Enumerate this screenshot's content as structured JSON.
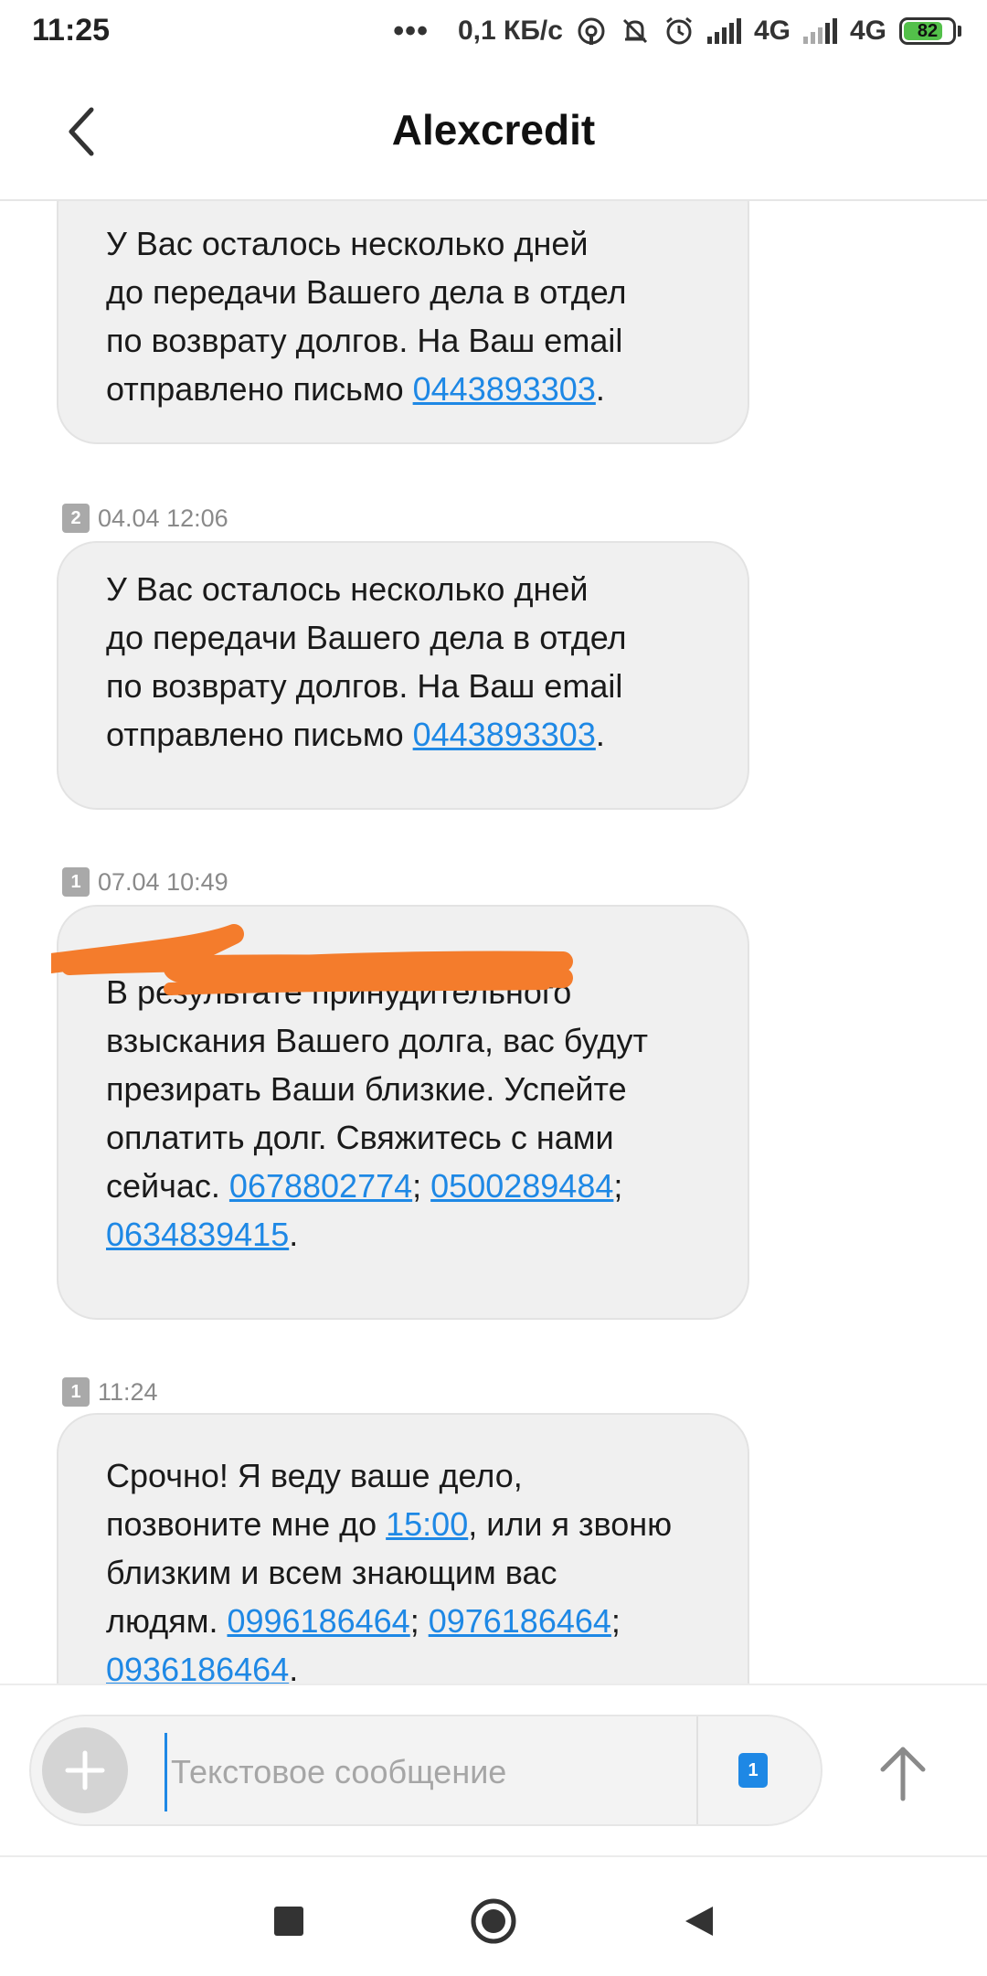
{
  "status_bar": {
    "time": "11:25",
    "dots": "•••",
    "net_speed": "0,1 КБ/с",
    "network_1": "4G",
    "network_2": "4G",
    "battery": "82"
  },
  "header": {
    "title": "Alexcredit"
  },
  "messages": [
    {
      "lines": [
        {
          "parts": [
            {
              "t": "У Вас осталось несколько дней"
            }
          ]
        },
        {
          "parts": [
            {
              "t": "до передачи Вашего дела в отдел"
            }
          ]
        },
        {
          "parts": [
            {
              "t": "по возврату долгов. На Ваш email"
            }
          ]
        },
        {
          "parts": [
            {
              "t": "отправлено письмо "
            },
            {
              "link": "0443893303"
            },
            {
              "t": "."
            }
          ]
        }
      ]
    },
    {
      "sim": "2",
      "time": "04.04 12:06",
      "lines": [
        {
          "parts": [
            {
              "t": "У Вас осталось несколько дней"
            }
          ]
        },
        {
          "parts": [
            {
              "t": "до передачи Вашего дела в отдел"
            }
          ]
        },
        {
          "parts": [
            {
              "t": "по возврату долгов. На Ваш email"
            }
          ]
        },
        {
          "parts": [
            {
              "t": "отправлено письмо "
            },
            {
              "link": "0443893303"
            },
            {
              "t": "."
            }
          ]
        }
      ]
    },
    {
      "sim": "1",
      "time": "07.04 10:49",
      "lines": [
        {
          "parts": [
            {
              "t": ""
            }
          ]
        },
        {
          "parts": [
            {
              "t": "В результате принудительного"
            }
          ]
        },
        {
          "parts": [
            {
              "t": "взыскания Вашего долга, вас будут"
            }
          ]
        },
        {
          "parts": [
            {
              "t": "презирать Ваши близкие. Успейте"
            }
          ]
        },
        {
          "parts": [
            {
              "t": "оплатить долг. Свяжитесь с нами"
            }
          ]
        },
        {
          "parts": [
            {
              "t": "сейчас. "
            },
            {
              "link": "0678802774"
            },
            {
              "t": "; "
            },
            {
              "link": "0500289484"
            },
            {
              "t": ";"
            }
          ]
        },
        {
          "parts": [
            {
              "link": "0634839415"
            },
            {
              "t": "."
            }
          ]
        }
      ]
    },
    {
      "sim": "1",
      "time": "11:24",
      "lines": [
        {
          "parts": [
            {
              "t": "Срочно! Я веду ваше дело,"
            }
          ]
        },
        {
          "parts": [
            {
              "t": "позвоните мне до "
            },
            {
              "link": "15:00"
            },
            {
              "t": ", или я звоню"
            }
          ]
        },
        {
          "parts": [
            {
              "t": "близким и всем знающим вас"
            }
          ]
        },
        {
          "parts": [
            {
              "t": "людям. "
            },
            {
              "link": "0996186464"
            },
            {
              "t": "; "
            },
            {
              "link": "0976186464"
            },
            {
              "t": ";"
            }
          ]
        },
        {
          "parts": [
            {
              "link": "0936186464"
            },
            {
              "t": "."
            }
          ]
        }
      ]
    }
  ],
  "composer": {
    "placeholder": "Текстовое сообщение",
    "sim": "1"
  },
  "colors": {
    "link": "#1e88e5",
    "bubble": "#f0f0f0",
    "scribble": "#f47c2c",
    "sim_active": "#1e88e5"
  },
  "icons": {
    "back": "chevron-left-icon",
    "add": "plus-icon",
    "send": "arrow-up-icon",
    "nav_recents": "square-icon",
    "nav_home": "circle-icon",
    "nav_back": "triangle-left-icon"
  }
}
